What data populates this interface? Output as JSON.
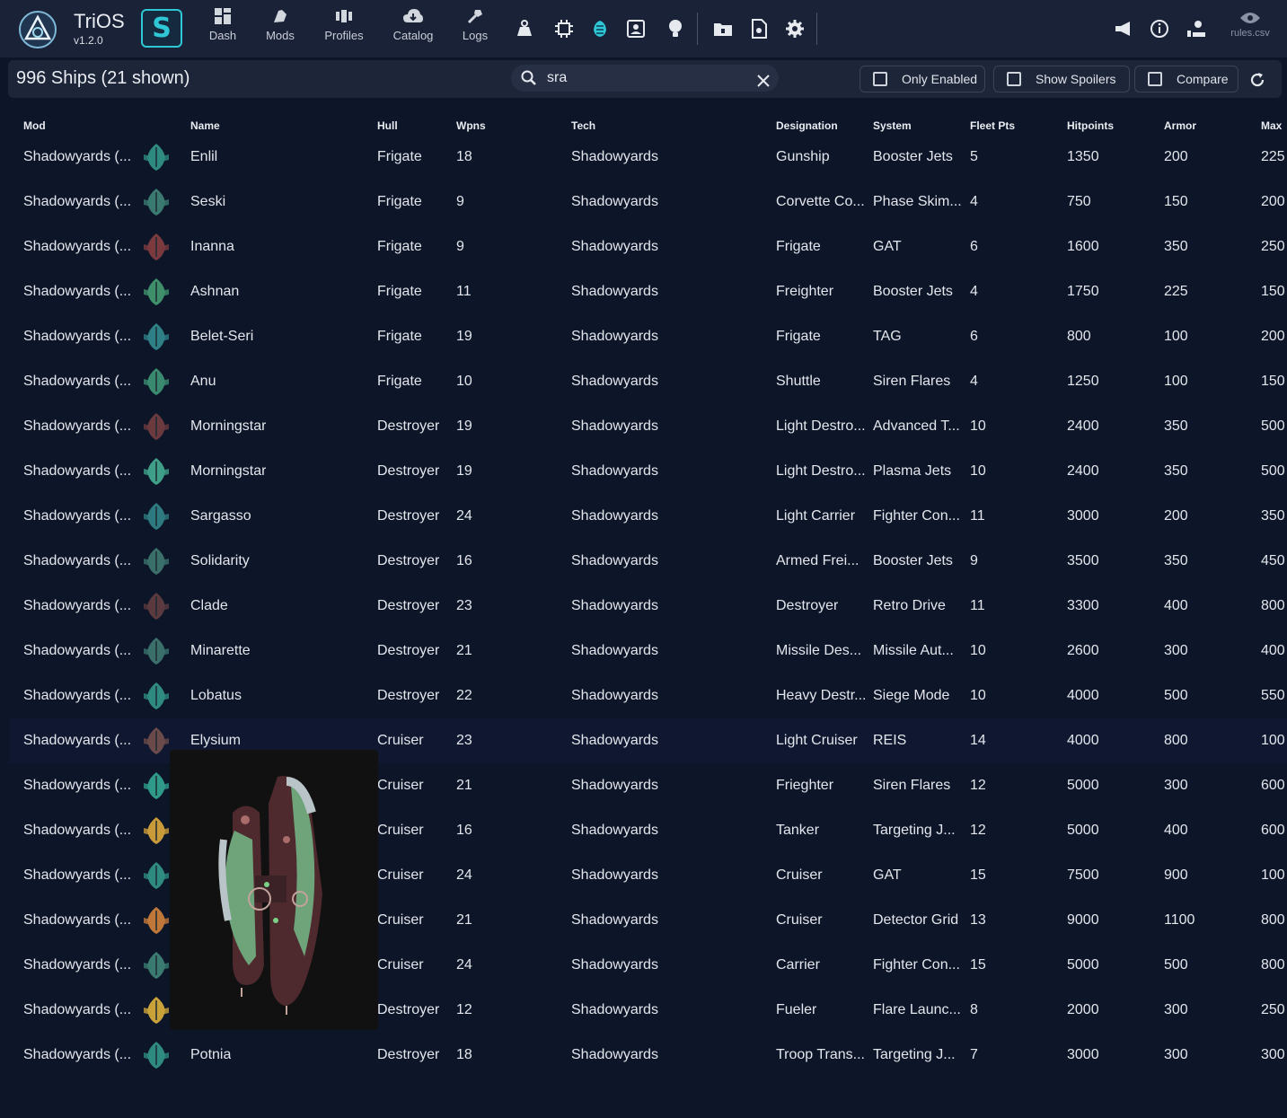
{
  "app": {
    "title": "TriOS",
    "version": "v1.2.0",
    "s_label": "S"
  },
  "nav": [
    {
      "label": "Dash",
      "icon": "dashboard-icon"
    },
    {
      "label": "Mods",
      "icon": "mods-icon"
    },
    {
      "label": "Profiles",
      "icon": "profiles-icon"
    },
    {
      "label": "Catalog",
      "icon": "catalog-icon"
    },
    {
      "label": "Logs",
      "icon": "logs-icon"
    }
  ],
  "toolbar_right": {
    "rules_label": "rules.csv"
  },
  "filter": {
    "count": "996 Ships (21 shown)",
    "search_value": "sra",
    "only_enabled": "Only Enabled",
    "show_spoilers": "Show Spoilers",
    "compare": "Compare"
  },
  "columns": [
    "Mod",
    "Name",
    "Hull",
    "Wpns",
    "Tech",
    "Designation",
    "System",
    "Fleet Pts",
    "Hitpoints",
    "Armor",
    "Max"
  ],
  "rows": [
    [
      "Shadowyards (...",
      "Enlil",
      "Frigate",
      "18",
      "Shadowyards",
      "Gunship",
      "Booster Jets",
      "5",
      "1350",
      "200",
      "225"
    ],
    [
      "Shadowyards (...",
      "Seski",
      "Frigate",
      "9",
      "Shadowyards",
      "Corvette Co...",
      "Phase Skim...",
      "4",
      "750",
      "150",
      "200"
    ],
    [
      "Shadowyards (...",
      "Inanna",
      "Frigate",
      "9",
      "Shadowyards",
      "Frigate",
      "GAT",
      "6",
      "1600",
      "350",
      "250"
    ],
    [
      "Shadowyards (...",
      "Ashnan",
      "Frigate",
      "11",
      "Shadowyards",
      "Freighter",
      "Booster Jets",
      "4",
      "1750",
      "225",
      "150"
    ],
    [
      "Shadowyards (...",
      "Belet-Seri",
      "Frigate",
      "19",
      "Shadowyards",
      "Frigate",
      "TAG",
      "6",
      "800",
      "100",
      "200"
    ],
    [
      "Shadowyards (...",
      "Anu",
      "Frigate",
      "10",
      "Shadowyards",
      "Shuttle",
      "Siren Flares",
      "4",
      "1250",
      "100",
      "150"
    ],
    [
      "Shadowyards (...",
      "Morningstar",
      "Destroyer",
      "19",
      "Shadowyards",
      "Light Destro...",
      "Advanced T...",
      "10",
      "2400",
      "350",
      "500"
    ],
    [
      "Shadowyards (...",
      "Morningstar",
      "Destroyer",
      "19",
      "Shadowyards",
      "Light Destro...",
      "Plasma Jets",
      "10",
      "2400",
      "350",
      "500"
    ],
    [
      "Shadowyards (...",
      "Sargasso",
      "Destroyer",
      "24",
      "Shadowyards",
      "Light Carrier",
      "Fighter Con...",
      "11",
      "3000",
      "200",
      "350"
    ],
    [
      "Shadowyards (...",
      "Solidarity",
      "Destroyer",
      "16",
      "Shadowyards",
      "Armed Frei...",
      "Booster Jets",
      "9",
      "3500",
      "350",
      "450"
    ],
    [
      "Shadowyards (...",
      "Clade",
      "Destroyer",
      "23",
      "Shadowyards",
      "Destroyer",
      "Retro Drive",
      "11",
      "3300",
      "400",
      "800"
    ],
    [
      "Shadowyards (...",
      "Minarette",
      "Destroyer",
      "21",
      "Shadowyards",
      "Missile Des...",
      "Missile Aut...",
      "10",
      "2600",
      "300",
      "400"
    ],
    [
      "Shadowyards (...",
      "Lobatus",
      "Destroyer",
      "22",
      "Shadowyards",
      "Heavy Destr...",
      "Siege Mode",
      "10",
      "4000",
      "500",
      "550"
    ],
    [
      "Shadowyards (...",
      "Elysium",
      "Cruiser",
      "23",
      "Shadowyards",
      "Light Cruiser",
      "REIS",
      "14",
      "4000",
      "800",
      "100"
    ],
    [
      "Shadowyards (...",
      "",
      "Cruiser",
      "21",
      "Shadowyards",
      "Frieghter",
      "Siren Flares",
      "12",
      "5000",
      "300",
      "600"
    ],
    [
      "Shadowyards (...",
      "",
      "Cruiser",
      "16",
      "Shadowyards",
      "Tanker",
      "Targeting J...",
      "12",
      "5000",
      "400",
      "600"
    ],
    [
      "Shadowyards (...",
      "",
      "Cruiser",
      "24",
      "Shadowyards",
      "Cruiser",
      "GAT",
      "15",
      "7500",
      "900",
      "100"
    ],
    [
      "Shadowyards (...",
      "",
      "Cruiser",
      "21",
      "Shadowyards",
      "Cruiser",
      "Detector Grid",
      "13",
      "9000",
      "1100",
      "800"
    ],
    [
      "Shadowyards (...",
      "",
      "Cruiser",
      "24",
      "Shadowyards",
      "Carrier",
      "Fighter Con...",
      "15",
      "5000",
      "500",
      "800"
    ],
    [
      "Shadowyards (...",
      "",
      "Destroyer",
      "12",
      "Shadowyards",
      "Fueler",
      "Flare Launc...",
      "8",
      "2000",
      "300",
      "250"
    ],
    [
      "Shadowyards (...",
      "Potnia",
      "Destroyer",
      "18",
      "Shadowyards",
      "Troop Trans...",
      "Targeting J...",
      "7",
      "3000",
      "300",
      "300"
    ]
  ],
  "highlight_row": 13,
  "colors": {
    "accent": "#2fc6d6",
    "background": "#0d1528",
    "topbar": "#1a2238"
  }
}
